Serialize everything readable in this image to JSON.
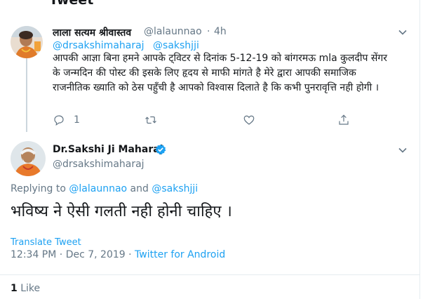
{
  "header": {
    "title": "Tweet"
  },
  "reply_tweet": {
    "name": "लाला सत्यम श्रीवास्तव",
    "handle": "@lalaunnao",
    "dot": "·",
    "time": "4h",
    "mentions": [
      "@drsakshimaharaj",
      "@sakshjji"
    ],
    "text": "आपकी आज्ञा बिना हमने आपके ट्विटर से दिनांक 5-12-19 को बांगरमऊ mla कुलदीप सेंगर के जन्मदिन की पोस्ट की इसके लिए हृदय से माफी मांगते है मेरे द्वारा आपकी समाजिक राजनीतिक ख्याति को ठेस पहुँची है आपको विश्वास दिलाते है कि कभी पुनरावृत्ति नही होगी ।",
    "actions": {
      "reply_count": "1"
    }
  },
  "main_tweet": {
    "name": "Dr.Sakshi Ji Maharaj",
    "handle": "@drsakshimaharaj",
    "replying_prefix": "Replying to ",
    "replying_to_1": "@lalaunnao",
    "replying_and": " and ",
    "replying_to_2": "@sakshjji",
    "text": "भविष्य ने ऐसी गलती नही होनी चाहिए ।",
    "translate_label": "Translate Tweet",
    "time": "12:34 PM",
    "date_sep": " · ",
    "date": "Dec 7, 2019",
    "source_sep": " · ",
    "source": "Twitter for Android",
    "like_count": "1",
    "like_label": " Like"
  },
  "colors": {
    "accent": "#1da1f2",
    "secondary_text": "#657786",
    "border": "#e6ecf0"
  }
}
